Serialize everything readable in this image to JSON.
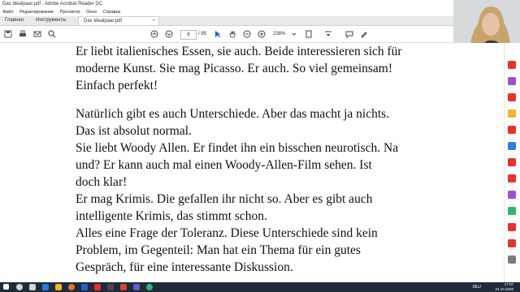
{
  "window": {
    "title": "Das Idealpaar.pdf - Adobe Acrobat Reader DC"
  },
  "menu": [
    "Файл",
    "Редактирование",
    "Просмотр",
    "Окно",
    "Справка"
  ],
  "tabs": {
    "home": "Главная",
    "tools": "Инструменты",
    "document": "Das Idealpaar.pdf",
    "close": "×"
  },
  "toolbar": {
    "page_current": "8",
    "page_total": "/ 95",
    "zoom": "238%"
  },
  "document": {
    "lines": [
      "Er liebt italienisches Essen, sie auch. Beide interessieren sich für",
      "moderne Kunst. Sie mag Picasso. Er auch. So viel gemeinsam!",
      "Einfach perfekt!",
      "",
      "Natürlich gibt es auch Unterschiede. Aber das macht ja nichts.",
      "Das ist absolut normal.",
      "Sie liebt Woody Allen. Er findet ihn ein bisschen neurotisch. Na",
      "und? Er kann auch mal einen Woody-Allen-Film sehen. Ist",
      "doch klar!",
      "Er mag Krimis. Die gefallen ihr nicht so. Aber es gibt auch",
      "intelligente Krimis, das stimmt schon.",
      "Alles eine Frage der Toleranz. Diese Unterschiede sind kein",
      "Problem, im Gegenteil: Man hat ein Thema für ein gutes",
      "Gespräch, für eine interessante Diskussion."
    ]
  },
  "taskbar": {
    "language": "DEU",
    "time": "17:07",
    "date": "24.10.2020"
  },
  "colors": {
    "taskbar": "#1f2b38",
    "sidebar_icons": [
      "#e5322d",
      "#9c4fd6",
      "#e5322d",
      "#f2b531",
      "#e5322d",
      "#2d7fe5",
      "#e5322d",
      "#e5322d",
      "#9c4fd6",
      "#2bb673",
      "#e5322d",
      "#e5322d",
      "#7a7a7a"
    ]
  }
}
